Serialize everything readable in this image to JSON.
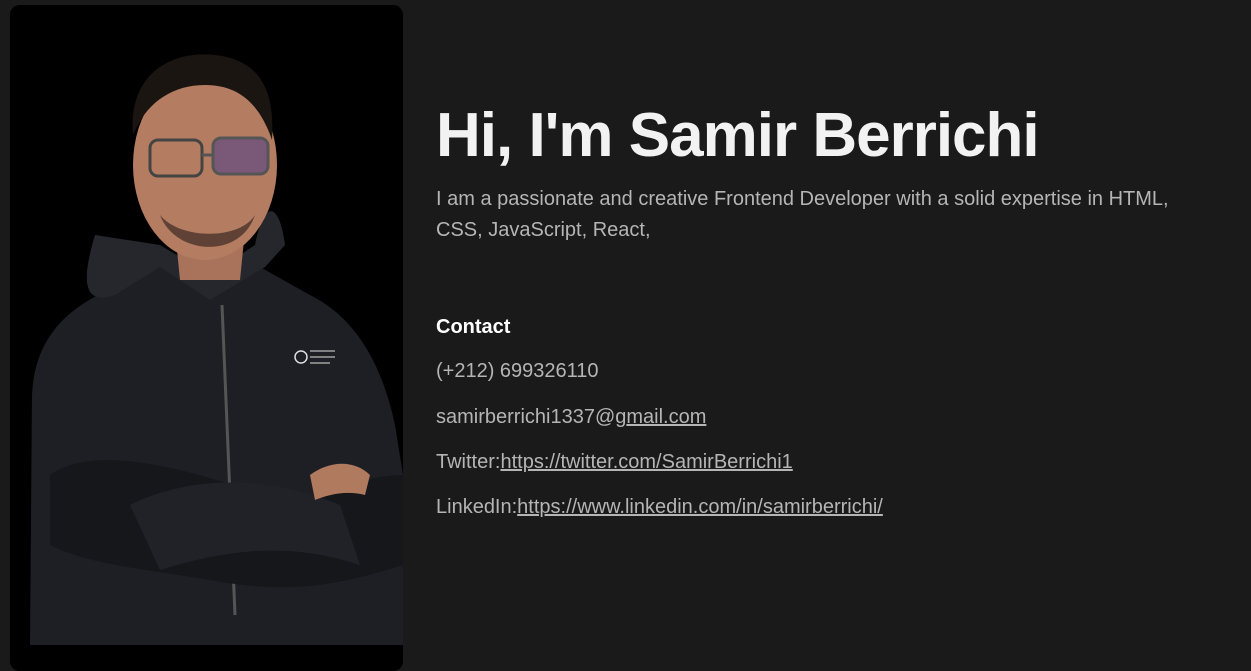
{
  "hero": {
    "title": "Hi, I'm Samir Berrichi",
    "intro": "I am a passionate and creative Frontend Developer with a solid expertise in HTML, CSS, JavaScript, React,"
  },
  "contact": {
    "heading": "Contact",
    "phone": "(+212) 699326110",
    "email_prefix": "samirberrichi1337@g",
    "email_link": "mail.com",
    "twitter_label": "Twitter:",
    "twitter_url": "https://twitter.com/SamirBerrichi1",
    "linkedin_label": "LinkedIn:",
    "linkedin_url": "https://www.linkedin.com/in/samirberrichi/"
  },
  "colors": {
    "background": "#1a1a1a",
    "title": "#f2f2f2",
    "body_text": "#b5b5b5",
    "photo_bg": "#000000"
  }
}
